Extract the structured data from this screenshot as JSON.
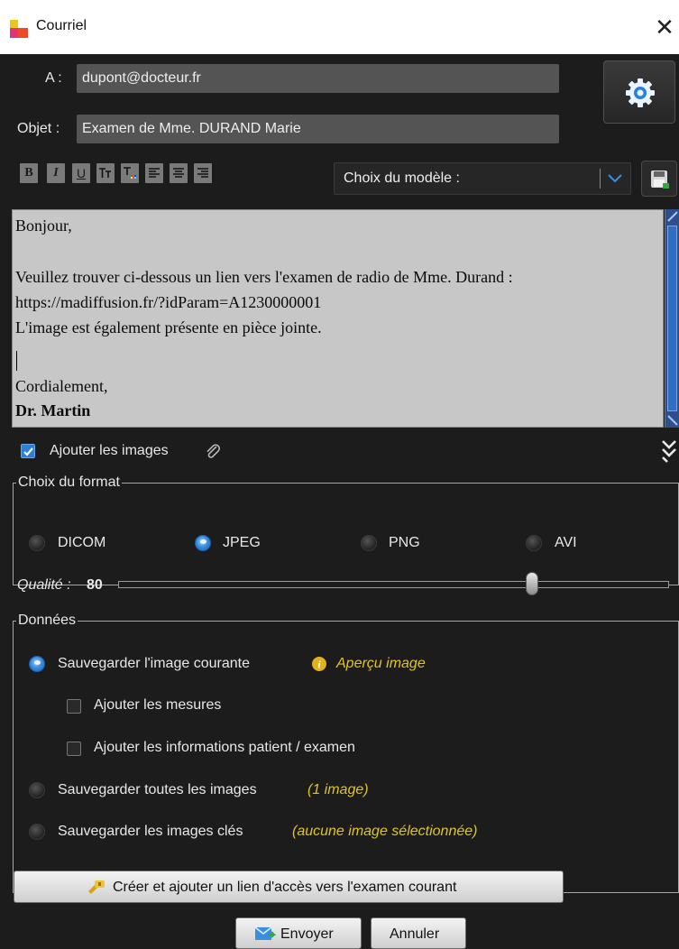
{
  "window": {
    "title": "Courriel"
  },
  "mail": {
    "to_label": "A :",
    "to_value": "dupont@docteur.fr",
    "subject_label": "Objet :",
    "subject_value": "Examen de Mme. DURAND Marie"
  },
  "toolbar": {
    "bold": "B",
    "italic": "I",
    "underline": "U",
    "model_select": "Choix du modèle :"
  },
  "body": {
    "lines": [
      "Bonjour,",
      "",
      "Veuillez trouver ci-dessous un lien vers l'examen de radio de Mme. Durand :",
      "https://madiffusion.fr/?idParam=A1230000001",
      "L'image est également présente en pièce jointe.",
      "",
      "Cordialement,",
      "Dr. Martin"
    ]
  },
  "attach": {
    "label": "Ajouter les images",
    "checked": true
  },
  "format": {
    "legend": "Choix du format",
    "options": [
      "DICOM",
      "JPEG",
      "PNG",
      "AVI"
    ],
    "selected": "JPEG",
    "quality_label": "Qualité : ",
    "quality_value": "80",
    "quality_fraction": 0.8
  },
  "data_section": {
    "legend": "Données",
    "save_current": "Sauvegarder l'image courante",
    "preview_link": "Aperçu image",
    "add_measures": "Ajouter les mesures",
    "add_patient_info": "Ajouter les informations patient / examen",
    "save_all": "Sauvegarder toutes les images",
    "save_all_count": "(1 image)",
    "save_key": "Sauvegarder les images clés",
    "save_key_count": "(aucune image sélectionnée)",
    "selected": "save_current"
  },
  "actions": {
    "create_link": "Créer et ajouter un lien d'accès vers l'examen courant",
    "send": "Envoyer",
    "cancel": "Annuler"
  },
  "colors": {
    "background": "#1c1c1c",
    "field": "#545454",
    "body_bg": "#c7c7c7",
    "accent_yellow": "#e0c420",
    "radio_blue": "#3a8ee0"
  }
}
